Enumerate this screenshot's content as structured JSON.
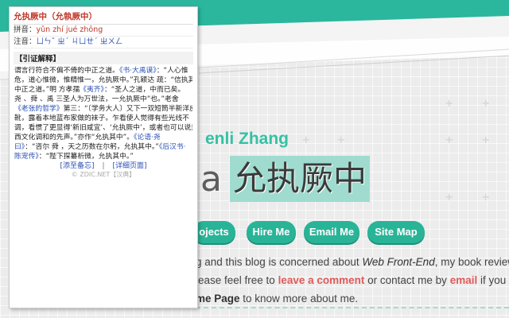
{
  "blog": {
    "author_partial": "enli Zhang",
    "title_prefix": "a",
    "title_highlight": "允执厥中",
    "nav": [
      "ojects",
      "Hire Me",
      "Email Me",
      "Site Map"
    ],
    "intro": {
      "l1_a": "g and this blog is concerned about ",
      "l1_em": "Web Front-End",
      "l1_b": ", my book reviews and",
      "l2_a": "lease feel free to ",
      "l2_link1": "leave a comment",
      "l2_b": " or contact me by ",
      "l2_link2": "email",
      "l2_c": " if you have a",
      "l3_b": "me Page",
      "l3_a": " to know more about me."
    },
    "colors": {
      "accent": "#2ab79e",
      "highlight": "#9fdccf",
      "link": "#e15a5a"
    }
  },
  "popup": {
    "headword": "允执厥中（允執厥中）",
    "pinyin_label": "拼音：",
    "pinyin": "yǔn zhí jué zhōng",
    "zhuyin_label": "注音：",
    "zhuyin": "ㄩㄣˇ ㄓˊ ㄐㄩㄝˊ ㄓㄨㄥ",
    "section": "【引证解释】",
    "lines": [
      [
        "谓言行符合不偏不倚的中正之道。",
        "《书·大禹谟》",
        "：“人心惟"
      ],
      [
        "危，道心惟微，惟精惟一，允执厥中。”",
        "",
        "孔颖达 疏：“信执其"
      ],
      [
        "中正之道。”",
        "明 方孝孺",
        "《夷齐》",
        "：“圣人之道，中而已矣。"
      ],
      [
        "尧 、舜 、禹 三圣人为万世法，一允执厥中”也。”",
        "",
        "老舍"
      ],
      [
        "",
        "《老张的哲学》",
        "第三：“〔学务大人〕又下一双短筒半新洋皮"
      ],
      [
        "靴，露着本地蓝布家做的袜子。乍看使人觉得有些光线不"
      ],
      [
        "调，看惯了更显得‘新旧咸宜’、‘允执厥中’，或者也可以说是东"
      ],
      [
        "西文化调和的先声。”亦作“允执其中”。",
        "《论语·尧"
      ],
      [
        "曰》",
        "：“咨尔 舜 ，天之历数在尔躬，允执其中。”",
        "《后汉书·"
      ],
      [
        "陈宠传》",
        "：“陛下探纂析微，允执其中。”"
      ]
    ],
    "links": [
      "[添至备忘]",
      "|",
      "[详细页面]"
    ],
    "copyright": "© ZDIC.NET【汉典】"
  }
}
